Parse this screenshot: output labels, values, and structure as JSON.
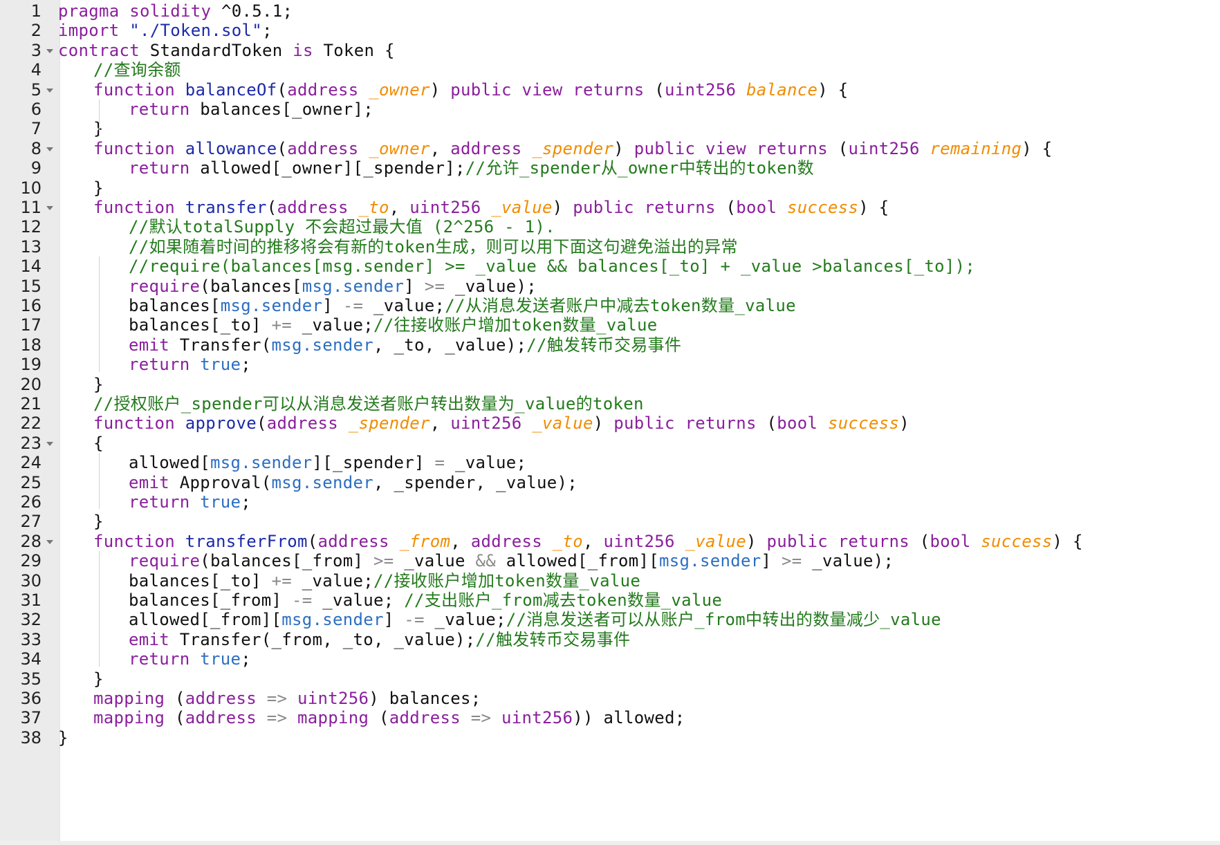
{
  "editor": {
    "lines": [
      {
        "n": "1",
        "fold": false,
        "indent": 0,
        "tokens": [
          [
            "kw",
            "pragma"
          ],
          [
            "tx",
            " "
          ],
          [
            "kw",
            "solidity"
          ],
          [
            "tx",
            " ^0.5.1;"
          ]
        ]
      },
      {
        "n": "2",
        "fold": false,
        "indent": 0,
        "tokens": [
          [
            "kw",
            "import"
          ],
          [
            "tx",
            " "
          ],
          [
            "st",
            "\"./Token.sol\""
          ],
          [
            "tx",
            ";"
          ]
        ]
      },
      {
        "n": "3",
        "fold": true,
        "indent": 0,
        "tokens": [
          [
            "kw",
            "contract"
          ],
          [
            "tx",
            " StandardToken "
          ],
          [
            "kw",
            "is"
          ],
          [
            "tx",
            " Token {"
          ]
        ]
      },
      {
        "n": "4",
        "fold": false,
        "indent": 1,
        "tokens": [
          [
            "cm",
            "//查询余额"
          ]
        ]
      },
      {
        "n": "5",
        "fold": true,
        "indent": 1,
        "tokens": [
          [
            "kw",
            "function"
          ],
          [
            "tx",
            " "
          ],
          [
            "fn",
            "balanceOf"
          ],
          [
            "tx",
            "("
          ],
          [
            "kw",
            "address"
          ],
          [
            "tx",
            " "
          ],
          [
            "pn",
            "_owner"
          ],
          [
            "tx",
            ") "
          ],
          [
            "kw",
            "public"
          ],
          [
            "tx",
            " "
          ],
          [
            "kw",
            "view"
          ],
          [
            "tx",
            " "
          ],
          [
            "kw",
            "returns"
          ],
          [
            "tx",
            " ("
          ],
          [
            "kw",
            "uint256"
          ],
          [
            "tx",
            " "
          ],
          [
            "pn",
            "balance"
          ],
          [
            "tx",
            ") {"
          ]
        ]
      },
      {
        "n": "6",
        "fold": false,
        "indent": 2,
        "tokens": [
          [
            "kw",
            "return"
          ],
          [
            "tx",
            " balances[_owner];"
          ]
        ]
      },
      {
        "n": "7",
        "fold": false,
        "indent": 1,
        "tokens": [
          [
            "tx",
            "}"
          ]
        ]
      },
      {
        "n": "8",
        "fold": true,
        "indent": 1,
        "tokens": [
          [
            "kw",
            "function"
          ],
          [
            "tx",
            " "
          ],
          [
            "fn",
            "allowance"
          ],
          [
            "tx",
            "("
          ],
          [
            "kw",
            "address"
          ],
          [
            "tx",
            " "
          ],
          [
            "pn",
            "_owner"
          ],
          [
            "tx",
            ", "
          ],
          [
            "kw",
            "address"
          ],
          [
            "tx",
            " "
          ],
          [
            "pn",
            "_spender"
          ],
          [
            "tx",
            ") "
          ],
          [
            "kw",
            "public"
          ],
          [
            "tx",
            " "
          ],
          [
            "kw",
            "view"
          ],
          [
            "tx",
            " "
          ],
          [
            "kw",
            "returns"
          ],
          [
            "tx",
            " ("
          ],
          [
            "kw",
            "uint256"
          ],
          [
            "tx",
            " "
          ],
          [
            "pn",
            "remaining"
          ],
          [
            "tx",
            ") {"
          ]
        ]
      },
      {
        "n": "9",
        "fold": false,
        "indent": 2,
        "tokens": [
          [
            "kw",
            "return"
          ],
          [
            "tx",
            " allowed[_owner][_spender];"
          ],
          [
            "cm",
            "//允许_spender从_owner中转出的token数"
          ]
        ]
      },
      {
        "n": "10",
        "fold": false,
        "indent": 1,
        "tokens": [
          [
            "tx",
            "}"
          ]
        ]
      },
      {
        "n": "11",
        "fold": true,
        "indent": 1,
        "tokens": [
          [
            "kw",
            "function"
          ],
          [
            "tx",
            " "
          ],
          [
            "fn",
            "transfer"
          ],
          [
            "tx",
            "("
          ],
          [
            "kw",
            "address"
          ],
          [
            "tx",
            " "
          ],
          [
            "pn",
            "_to"
          ],
          [
            "tx",
            ", "
          ],
          [
            "kw",
            "uint256"
          ],
          [
            "tx",
            " "
          ],
          [
            "pn",
            "_value"
          ],
          [
            "tx",
            ") "
          ],
          [
            "kw",
            "public"
          ],
          [
            "tx",
            " "
          ],
          [
            "kw",
            "returns"
          ],
          [
            "tx",
            " ("
          ],
          [
            "kw",
            "bool"
          ],
          [
            "tx",
            " "
          ],
          [
            "pn",
            "success"
          ],
          [
            "tx",
            ") {"
          ]
        ]
      },
      {
        "n": "12",
        "fold": false,
        "indent": 2,
        "tokens": [
          [
            "cm",
            "//默认totalSupply 不会超过最大值 (2^256 - 1)."
          ]
        ]
      },
      {
        "n": "13",
        "fold": false,
        "indent": 2,
        "tokens": [
          [
            "cm",
            "//如果随着时间的推移将会有新的token生成，则可以用下面这句避免溢出的异常"
          ]
        ]
      },
      {
        "n": "14",
        "fold": false,
        "indent": 2,
        "tokens": [
          [
            "cm",
            "//require(balances[msg.sender] >= _value && balances[_to] + _value >balances[_to]);"
          ]
        ]
      },
      {
        "n": "15",
        "fold": false,
        "indent": 2,
        "tokens": [
          [
            "kw",
            "require"
          ],
          [
            "tx",
            "(balances["
          ],
          [
            "lit",
            "msg.sender"
          ],
          [
            "tx",
            "] "
          ],
          [
            "op",
            ">="
          ],
          [
            "tx",
            " _value);"
          ]
        ]
      },
      {
        "n": "16",
        "fold": false,
        "indent": 2,
        "tokens": [
          [
            "tx",
            "balances["
          ],
          [
            "lit",
            "msg.sender"
          ],
          [
            "tx",
            "] "
          ],
          [
            "op",
            "-="
          ],
          [
            "tx",
            " _value;"
          ],
          [
            "cm",
            "//从消息发送者账户中减去token数量_value"
          ]
        ]
      },
      {
        "n": "17",
        "fold": false,
        "indent": 2,
        "tokens": [
          [
            "tx",
            "balances[_to] "
          ],
          [
            "op",
            "+="
          ],
          [
            "tx",
            " _value;"
          ],
          [
            "cm",
            "//往接收账户增加token数量_value"
          ]
        ]
      },
      {
        "n": "18",
        "fold": false,
        "indent": 2,
        "tokens": [
          [
            "kw",
            "emit"
          ],
          [
            "tx",
            " Transfer("
          ],
          [
            "lit",
            "msg.sender"
          ],
          [
            "tx",
            ", _to, _value);"
          ],
          [
            "cm",
            "//触发转币交易事件"
          ]
        ]
      },
      {
        "n": "19",
        "fold": false,
        "indent": 2,
        "tokens": [
          [
            "kw",
            "return"
          ],
          [
            "tx",
            " "
          ],
          [
            "lit",
            "true"
          ],
          [
            "tx",
            ";"
          ]
        ]
      },
      {
        "n": "20",
        "fold": false,
        "indent": 1,
        "tokens": [
          [
            "tx",
            "}"
          ]
        ]
      },
      {
        "n": "21",
        "fold": false,
        "indent": 1,
        "tokens": [
          [
            "cm",
            "//授权账户_spender可以从消息发送者账户转出数量为_value的token"
          ]
        ]
      },
      {
        "n": "22",
        "fold": false,
        "indent": 1,
        "tokens": [
          [
            "kw",
            "function"
          ],
          [
            "tx",
            " "
          ],
          [
            "fn",
            "approve"
          ],
          [
            "tx",
            "("
          ],
          [
            "kw",
            "address"
          ],
          [
            "tx",
            " "
          ],
          [
            "pn",
            "_spender"
          ],
          [
            "tx",
            ", "
          ],
          [
            "kw",
            "uint256"
          ],
          [
            "tx",
            " "
          ],
          [
            "pn",
            "_value"
          ],
          [
            "tx",
            ") "
          ],
          [
            "kw",
            "public"
          ],
          [
            "tx",
            " "
          ],
          [
            "kw",
            "returns"
          ],
          [
            "tx",
            " ("
          ],
          [
            "kw",
            "bool"
          ],
          [
            "tx",
            " "
          ],
          [
            "pn",
            "success"
          ],
          [
            "tx",
            ")"
          ]
        ]
      },
      {
        "n": "23",
        "fold": true,
        "indent": 1,
        "tokens": [
          [
            "tx",
            "{"
          ]
        ]
      },
      {
        "n": "24",
        "fold": false,
        "indent": 2,
        "tokens": [
          [
            "tx",
            "allowed["
          ],
          [
            "lit",
            "msg.sender"
          ],
          [
            "tx",
            "][_spender] "
          ],
          [
            "op",
            "="
          ],
          [
            "tx",
            " _value;"
          ]
        ]
      },
      {
        "n": "25",
        "fold": false,
        "indent": 2,
        "tokens": [
          [
            "kw",
            "emit"
          ],
          [
            "tx",
            " Approval("
          ],
          [
            "lit",
            "msg.sender"
          ],
          [
            "tx",
            ", _spender, _value);"
          ]
        ]
      },
      {
        "n": "26",
        "fold": false,
        "indent": 2,
        "tokens": [
          [
            "kw",
            "return"
          ],
          [
            "tx",
            " "
          ],
          [
            "lit",
            "true"
          ],
          [
            "tx",
            ";"
          ]
        ]
      },
      {
        "n": "27",
        "fold": false,
        "indent": 1,
        "tokens": [
          [
            "tx",
            "}"
          ]
        ]
      },
      {
        "n": "28",
        "fold": true,
        "indent": 1,
        "tokens": [
          [
            "kw",
            "function"
          ],
          [
            "tx",
            " "
          ],
          [
            "fn",
            "transferFrom"
          ],
          [
            "tx",
            "("
          ],
          [
            "kw",
            "address"
          ],
          [
            "tx",
            " "
          ],
          [
            "pn",
            "_from"
          ],
          [
            "tx",
            ", "
          ],
          [
            "kw",
            "address"
          ],
          [
            "tx",
            " "
          ],
          [
            "pn",
            "_to"
          ],
          [
            "tx",
            ", "
          ],
          [
            "kw",
            "uint256"
          ],
          [
            "tx",
            " "
          ],
          [
            "pn",
            "_value"
          ],
          [
            "tx",
            ") "
          ],
          [
            "kw",
            "public"
          ],
          [
            "tx",
            " "
          ],
          [
            "kw",
            "returns"
          ],
          [
            "tx",
            " ("
          ],
          [
            "kw",
            "bool"
          ],
          [
            "tx",
            " "
          ],
          [
            "pn",
            "success"
          ],
          [
            "tx",
            ") {"
          ]
        ]
      },
      {
        "n": "29",
        "fold": false,
        "indent": 2,
        "tokens": [
          [
            "kw",
            "require"
          ],
          [
            "tx",
            "(balances[_from] "
          ],
          [
            "op",
            ">="
          ],
          [
            "tx",
            " _value "
          ],
          [
            "op",
            "&&"
          ],
          [
            "tx",
            " allowed[_from]["
          ],
          [
            "lit",
            "msg.sender"
          ],
          [
            "tx",
            "] "
          ],
          [
            "op",
            ">="
          ],
          [
            "tx",
            " _value);"
          ]
        ]
      },
      {
        "n": "30",
        "fold": false,
        "indent": 2,
        "tokens": [
          [
            "tx",
            "balances[_to] "
          ],
          [
            "op",
            "+="
          ],
          [
            "tx",
            " _value;"
          ],
          [
            "cm",
            "//接收账户增加token数量_value"
          ]
        ]
      },
      {
        "n": "31",
        "fold": false,
        "indent": 2,
        "tokens": [
          [
            "tx",
            "balances[_from] "
          ],
          [
            "op",
            "-="
          ],
          [
            "tx",
            " _value; "
          ],
          [
            "cm",
            "//支出账户_from减去token数量_value"
          ]
        ]
      },
      {
        "n": "32",
        "fold": false,
        "indent": 2,
        "tokens": [
          [
            "tx",
            "allowed[_from]["
          ],
          [
            "lit",
            "msg.sender"
          ],
          [
            "tx",
            "] "
          ],
          [
            "op",
            "-="
          ],
          [
            "tx",
            " _value;"
          ],
          [
            "cm",
            "//消息发送者可以从账户_from中转出的数量减少_value"
          ]
        ]
      },
      {
        "n": "33",
        "fold": false,
        "indent": 2,
        "tokens": [
          [
            "kw",
            "emit"
          ],
          [
            "tx",
            " Transfer(_from, _to, _value);"
          ],
          [
            "cm",
            "//触发转币交易事件"
          ]
        ]
      },
      {
        "n": "34",
        "fold": false,
        "indent": 2,
        "tokens": [
          [
            "kw",
            "return"
          ],
          [
            "tx",
            " "
          ],
          [
            "lit",
            "true"
          ],
          [
            "tx",
            ";"
          ]
        ]
      },
      {
        "n": "35",
        "fold": false,
        "indent": 1,
        "tokens": [
          [
            "tx",
            "}"
          ]
        ]
      },
      {
        "n": "36",
        "fold": false,
        "indent": 1,
        "tokens": [
          [
            "kw",
            "mapping"
          ],
          [
            "tx",
            " ("
          ],
          [
            "kw",
            "address"
          ],
          [
            "tx",
            " "
          ],
          [
            "op",
            "=>"
          ],
          [
            "tx",
            " "
          ],
          [
            "kw",
            "uint256"
          ],
          [
            "tx",
            ") balances;"
          ]
        ]
      },
      {
        "n": "37",
        "fold": false,
        "indent": 1,
        "tokens": [
          [
            "kw",
            "mapping"
          ],
          [
            "tx",
            " ("
          ],
          [
            "kw",
            "address"
          ],
          [
            "tx",
            " "
          ],
          [
            "op",
            "=>"
          ],
          [
            "tx",
            " "
          ],
          [
            "kw",
            "mapping"
          ],
          [
            "tx",
            " ("
          ],
          [
            "kw",
            "address"
          ],
          [
            "tx",
            " "
          ],
          [
            "op",
            "=>"
          ],
          [
            "tx",
            " "
          ],
          [
            "kw",
            "uint256"
          ],
          [
            "tx",
            ")) allowed;"
          ]
        ]
      },
      {
        "n": "38",
        "fold": false,
        "indent": 0,
        "tokens": [
          [
            "tx",
            "}"
          ]
        ]
      }
    ]
  },
  "colors": {
    "keyword": "#8a1f9c",
    "function_name": "#1c2aa8",
    "parameter": "#f08c00",
    "comment": "#237a1c",
    "literal": "#2c6ec2",
    "operator": "#8a8a8a",
    "gutter_background": "#ebebeb"
  },
  "icons": {
    "fold_marker": "triangle-down-icon"
  }
}
